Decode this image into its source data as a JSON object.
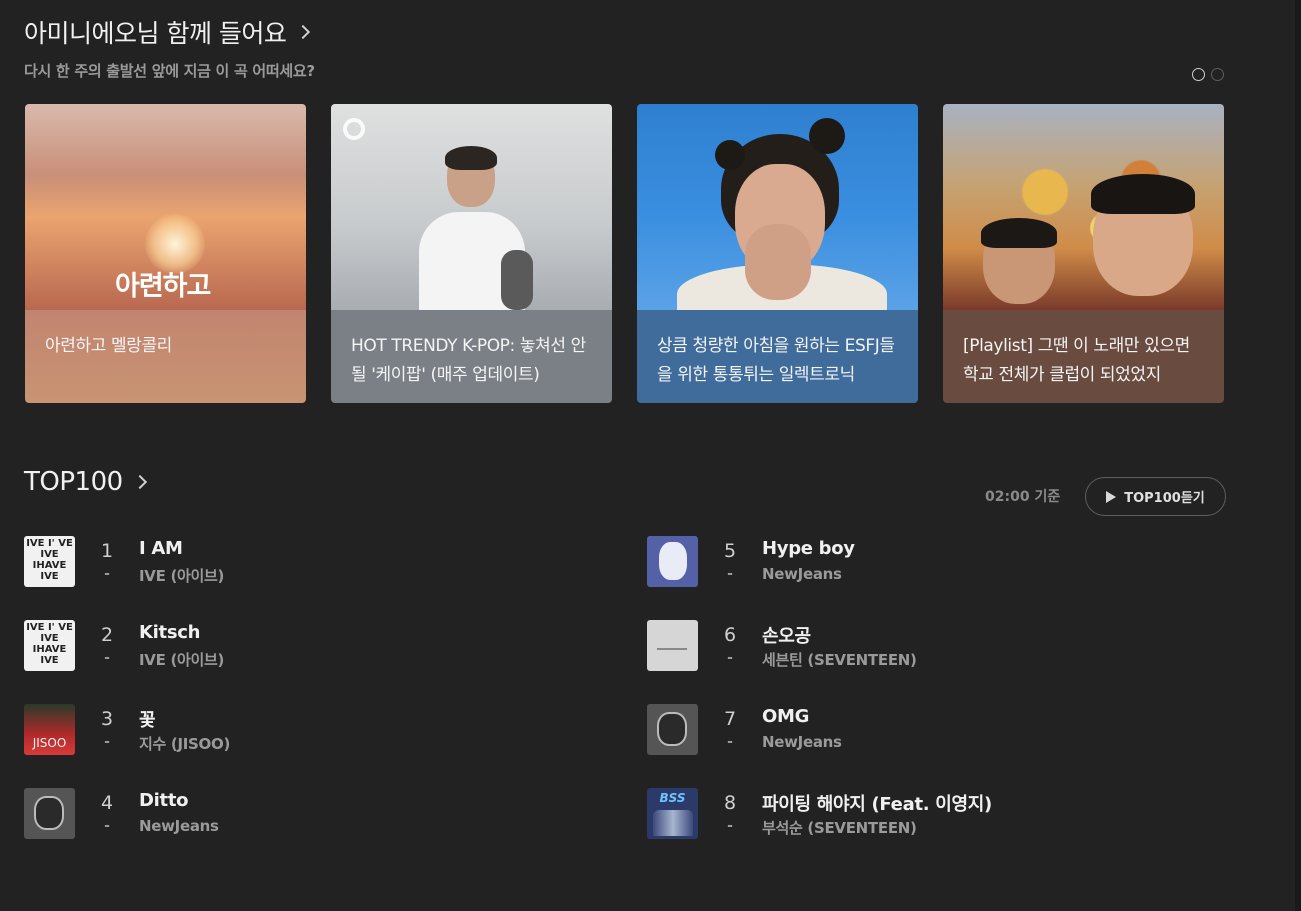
{
  "recommend": {
    "title": "아미니에오님 함께 들어요",
    "subtitle": "다시 한 주의 출발선 앞에 지금 이 곡 어떠세요?",
    "cards": [
      {
        "caption": "아련하고 멜랑콜리",
        "art_text": "아련하고"
      },
      {
        "caption": "HOT TRENDY K-POP: 놓쳐선 안될 '케이팝' (매주 업데이트)"
      },
      {
        "caption": "상큼 청량한 아침을 원하는 ESFJ들을 위한 통통튀는 일렉트로닉"
      },
      {
        "caption": "[Playlist] 그땐 이 노래만 있으면 학교 전체가 클럽이 되었었지"
      }
    ]
  },
  "top100": {
    "title": "TOP100",
    "basis_time": "02:00 기준",
    "play_all_label": "TOP100듣기",
    "left": [
      {
        "rank": "1",
        "trend": "-",
        "song": "I AM",
        "artist": "IVE (아이브)",
        "thumb": "ive-album-art"
      },
      {
        "rank": "2",
        "trend": "-",
        "song": "Kitsch",
        "artist": "IVE (아이브)",
        "thumb": "ive-album-art"
      },
      {
        "rank": "3",
        "trend": "-",
        "song": "꽃",
        "artist": "지수 (JISOO)",
        "thumb": "jisoo-album-art"
      },
      {
        "rank": "4",
        "trend": "-",
        "song": "Ditto",
        "artist": "NewJeans",
        "thumb": "newjeans-omg-album-art"
      }
    ],
    "right": [
      {
        "rank": "5",
        "trend": "-",
        "song": "Hype boy",
        "artist": "NewJeans",
        "thumb": "newjeans-album-art"
      },
      {
        "rank": "6",
        "trend": "-",
        "song": "손오공",
        "artist": "세븐틴 (SEVENTEEN)",
        "thumb": "seventeen-album-art"
      },
      {
        "rank": "7",
        "trend": "-",
        "song": "OMG",
        "artist": "NewJeans",
        "thumb": "newjeans-omg-album-art"
      },
      {
        "rank": "8",
        "trend": "-",
        "song": "파이팅 해야지 (Feat. 이영지)",
        "artist": "부석순 (SEVENTEEN)",
        "thumb": "bss-album-art"
      }
    ],
    "thumb_labels": {
      "ive": "IVE I' VE IVE IHAVE IVE",
      "jisoo": "JISOO",
      "bss": "BSS"
    }
  },
  "colors": {
    "background": "#222222",
    "text_primary": "#f0f0f0",
    "text_secondary": "#9a9a9a"
  }
}
